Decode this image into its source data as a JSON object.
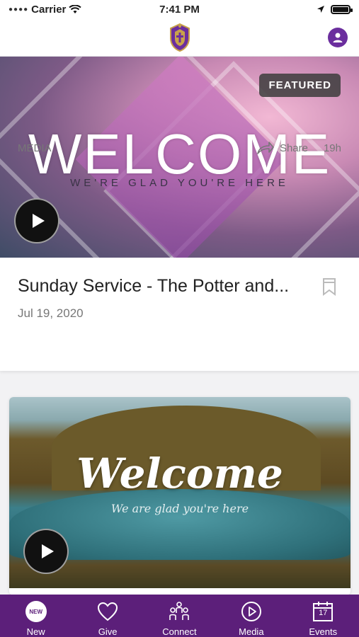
{
  "status_bar": {
    "carrier": "Carrier",
    "time": "7:41 PM"
  },
  "header": {
    "logo": "church-crest-logo",
    "profile_icon": "user-icon"
  },
  "featured_card": {
    "badge": "FEATURED",
    "hero_title": "WELCOME",
    "hero_subtitle": "WE'RE GLAD YOU'RE HERE",
    "title": "Sunday Service - The Potter and...",
    "date": "Jul 19, 2020",
    "category": "MEDIA",
    "share_label": "Share",
    "age": "19h"
  },
  "second_card": {
    "hero_title": "Welcome",
    "hero_subtitle": "We are glad you're here"
  },
  "tab_bar": {
    "tabs": [
      {
        "label": "New",
        "icon": "new-badge-icon",
        "badge": "NEW"
      },
      {
        "label": "Give",
        "icon": "heart-icon"
      },
      {
        "label": "Connect",
        "icon": "people-icon"
      },
      {
        "label": "Media",
        "icon": "play-circle-icon"
      },
      {
        "label": "Events",
        "icon": "calendar-icon",
        "day": "17"
      }
    ]
  },
  "colors": {
    "tab_bar": "#5c1f7a",
    "accent": "#6b2e9e"
  }
}
